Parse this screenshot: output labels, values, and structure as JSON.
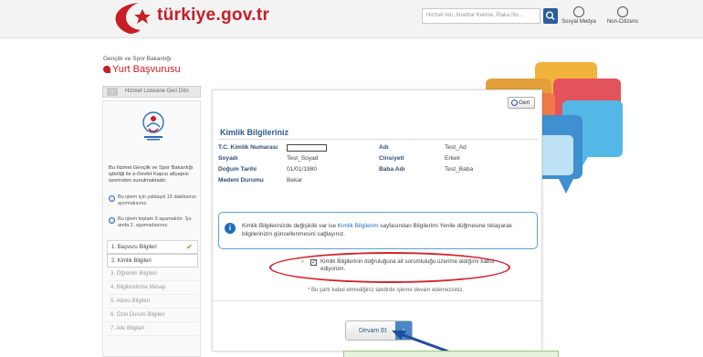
{
  "header": {
    "logo_text": "türkiye.gov.tr",
    "search_placeholder": "Hizmet Adı, Anahtar Kelime, Plaka No...",
    "social_label": "Sosyal Medya",
    "noncitizens_label": "Non-Citizens"
  },
  "service": {
    "ministry": "Gençlik ve Spor Bakanlığı",
    "title": "Yurt Başvurusu",
    "back_to_list": "Hizmet Listesine Geri Dön"
  },
  "sidebar": {
    "description": "Bu hizmet Gençlik ve Spor Bakanlığı işbirliği ile e-Devlet Kapısı altyapısı üzerinden sunulmaktadır.",
    "note_time": "Bu işlem için yaklaşık 15 dakikanızı ayırmalısınız.",
    "note_steps": "Bu işlem toplam 9 aşamalıdır. Şu anda 2. aşamadasınız.",
    "steps": [
      {
        "label": "1. Başvuru Bilgileri",
        "state": "done"
      },
      {
        "label": "2. Kimlik Bilgileri",
        "state": "active"
      },
      {
        "label": "3. Öğrenim Bilgileri",
        "state": "pending"
      },
      {
        "label": "4. Bilgilendirme Mesajı",
        "state": "pending"
      },
      {
        "label": "5. Adres Bilgileri",
        "state": "pending"
      },
      {
        "label": "6. Özel Durum Bilgileri",
        "state": "pending"
      },
      {
        "label": "7. Aile Bilgileri",
        "state": "pending"
      }
    ]
  },
  "panel": {
    "back_label": "Geri",
    "card_title": "Kimlik Bilgileriniz",
    "fields": {
      "tc_label": "T.C. Kimlik Numarası",
      "ad_label": "Adı",
      "ad_value": "Test_Ad",
      "soyad_label": "Soyadı",
      "soyad_value": "Test_Soyad",
      "cinsiyet_label": "Cinsiyeti",
      "cinsiyet_value": "Erkek",
      "dogum_label": "Doğum Tarihi",
      "dogum_value": "01/01/1980",
      "baba_label": "Baba Adı",
      "baba_value": "Test_Baba",
      "medeni_label": "Medeni Durumu",
      "medeni_value": "Bekar"
    },
    "info_part1": "Kimlik Bilgilerinizde değişiklik var ise ",
    "info_link": "Kimlik Bilgilerim",
    "info_part2": " sayfasından Bilgilerimi Yenile düğmesine tıklayarak bilgilerinizin güncellenmesini sağlayınız.",
    "agree_text": "Kimlik Bilgilerinin doğruluğuna ait sorumluluğu üzerime aldığımı kabul ediyorum.",
    "required_note": " Bu şartı kabul etmediğiniz takdirde işleme devam edemezsiniz.",
    "continue_label": "Devam Et"
  },
  "colors": {
    "brand_red": "#c81d25",
    "link_blue": "#2b5a8f",
    "annotation_red": "#d8232a",
    "annotation_arrow": "#1f4e9a"
  }
}
